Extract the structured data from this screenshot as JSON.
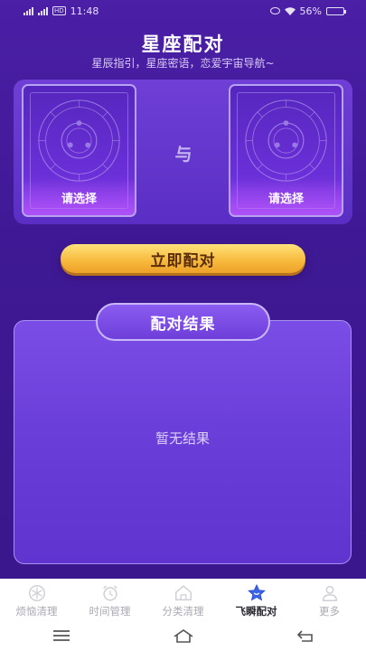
{
  "status_bar": {
    "time": "11:48",
    "network": "HD",
    "battery": "56%",
    "battery_level": 0.56
  },
  "header": {
    "title": "星座配对",
    "subtitle": "星辰指引，星座密语，恋爱宇宙导航~"
  },
  "selection": {
    "left_card_label": "请选择",
    "connector": "与",
    "right_card_label": "请选择"
  },
  "match_button_label": "立即配对",
  "result": {
    "title": "配对结果",
    "empty_text": "暂无结果"
  },
  "tab_bar": {
    "items": [
      {
        "label": "烦恼清理",
        "icon": "snowflake-icon",
        "active": false
      },
      {
        "label": "时间管理",
        "icon": "alarm-clock-icon",
        "active": false
      },
      {
        "label": "分类清理",
        "icon": "house-icon",
        "active": false
      },
      {
        "label": "飞瞬配对",
        "icon": "star-icon",
        "active": true
      },
      {
        "label": "更多",
        "icon": "person-icon",
        "active": false
      }
    ]
  },
  "nav_bar": {
    "buttons": [
      "menu-icon",
      "home-icon",
      "back-icon"
    ]
  },
  "colors": {
    "background": "#3f1a8f",
    "button_gold": "#f6b83a",
    "active_tab_star": "#3b63e8"
  }
}
